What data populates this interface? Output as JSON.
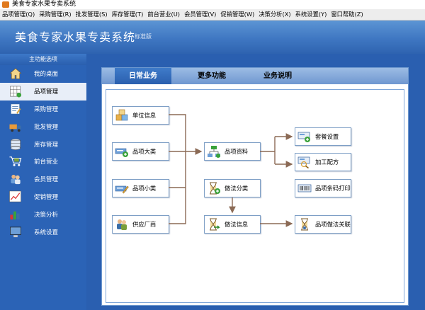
{
  "window": {
    "title": "美食专家水果专卖系统"
  },
  "menu": [
    "品项管理(Q)",
    "采购管理(R)",
    "批发管理(S)",
    "库存管理(T)",
    "前台营业(U)",
    "会员管理(V)",
    "促销管理(W)",
    "决策分析(X)",
    "系统设置(Y)",
    "窗口帮助(Z)"
  ],
  "banner": {
    "title": "美食专家水果专卖系统",
    "edition": "标准版"
  },
  "sidebar": {
    "header": "主功能选项",
    "items": [
      {
        "label": "我的桌面",
        "icon": "home-icon",
        "active": false
      },
      {
        "label": "品项管理",
        "icon": "grid-icon",
        "active": true
      },
      {
        "label": "采购管理",
        "icon": "notepad-icon",
        "active": false
      },
      {
        "label": "批发管理",
        "icon": "truck-icon",
        "active": false
      },
      {
        "label": "库存管理",
        "icon": "database-icon",
        "active": false
      },
      {
        "label": "前台营业",
        "icon": "cart-icon",
        "active": false
      },
      {
        "label": "会员管理",
        "icon": "members-icon",
        "active": false
      },
      {
        "label": "促销管理",
        "icon": "chart-icon",
        "active": false
      },
      {
        "label": "决策分析",
        "icon": "bar-chart-icon",
        "active": false
      },
      {
        "label": "系统设置",
        "icon": "monitor-icon",
        "active": false
      }
    ]
  },
  "tabs": [
    {
      "label": "日常业务",
      "active": true
    },
    {
      "label": "更多功能",
      "active": false
    },
    {
      "label": "业务说明",
      "active": false
    }
  ],
  "flow": {
    "unit_info": "单位信息",
    "category_major": "品项大类",
    "category_minor": "品项小类",
    "supplier": "供应厂商",
    "item_data": "品项资料",
    "method_category": "做法分类",
    "method_info": "做法信息",
    "combo_setup": "套餐设置",
    "processing_recipe": "加工配方",
    "barcode_print": "品项条码打印",
    "item_method_link": "品项做法关联"
  },
  "colors": {
    "accent": "#2b63b6",
    "arrow": "#8b6a55"
  }
}
